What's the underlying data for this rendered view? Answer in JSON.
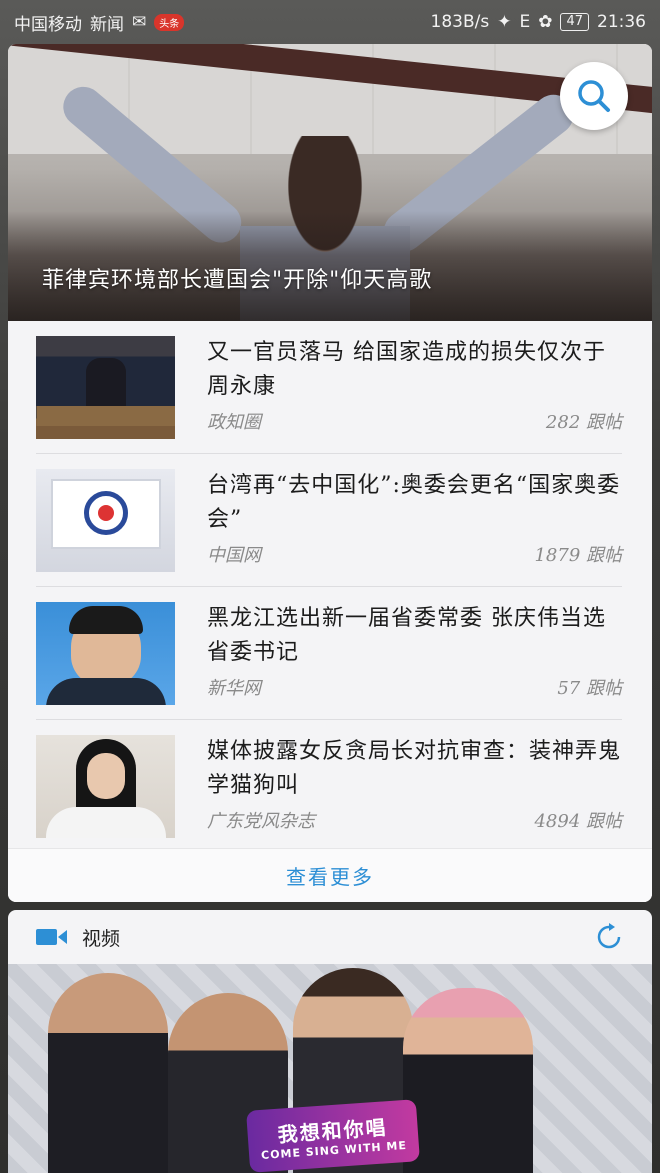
{
  "status_bar": {
    "carrier": "中国移动",
    "notification_app": "新闻",
    "badge": "头条",
    "network_speed": "183B/s",
    "signal_label": "E",
    "battery": "47",
    "time": "21:36"
  },
  "news": {
    "hero_caption": "菲律宾环境部长遭国会\"开除\"仰天高歌",
    "items": [
      {
        "title": "又一官员落马 给国家造成的损失仅次于周永康",
        "source": "政知圈",
        "comments": "282 跟帖"
      },
      {
        "title": "台湾再“去中国化”:奥委会更名“国家奥委会”",
        "source": "中国网",
        "comments": "1879 跟帖"
      },
      {
        "title": "黑龙江选出新一届省委常委 张庆伟当选省委书记",
        "source": "新华网",
        "comments": "57 跟帖"
      },
      {
        "title": "媒体披露女反贪局长对抗审查：装神弄鬼学猫狗叫",
        "source": "广东党风杂志",
        "comments": "4894 跟帖"
      }
    ],
    "see_more": "查看更多"
  },
  "video": {
    "title": "视频",
    "banner_logo_cn": "我想和你唱",
    "banner_logo_en": "COME SING WITH ME"
  },
  "colors": {
    "accent": "#2d8fd5",
    "card_bg": "#f4f4f6"
  }
}
